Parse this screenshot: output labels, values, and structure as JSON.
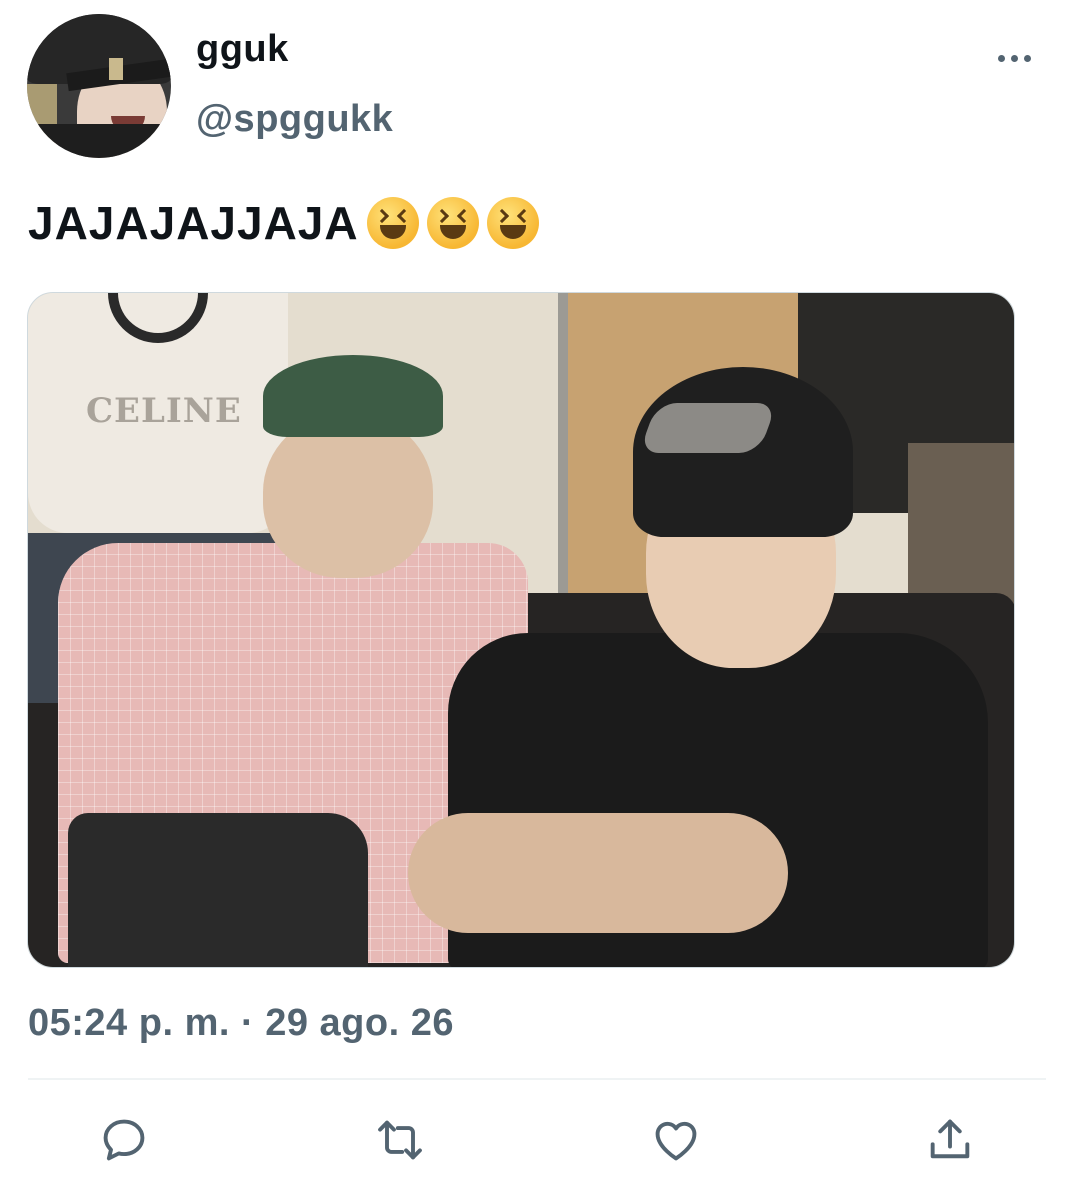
{
  "author": {
    "name": "gguk",
    "handle": "@spggukk"
  },
  "tweet": {
    "text": "JAJAJAJJAJA",
    "emoji": [
      "grinning-squinting-face",
      "grinning-squinting-face",
      "grinning-squinting-face"
    ],
    "timestamp": "05:24 p. m. · 29 ago. 26"
  },
  "media": {
    "print_text": "CELINE"
  },
  "icons": {
    "more": "more-horizontal-icon",
    "reply": "reply-icon",
    "retweet": "retweet-icon",
    "like": "like-icon",
    "share": "share-icon"
  },
  "colors": {
    "text": "#0f1419",
    "secondary": "#536471",
    "divider": "#eff3f4"
  }
}
